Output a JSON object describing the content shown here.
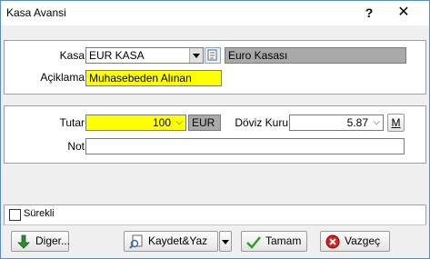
{
  "window": {
    "title": "Kasa Avansi",
    "help": "?",
    "close": "✕"
  },
  "form": {
    "kasa_label": "Kasa",
    "kasa_value": "EUR KASA",
    "kasa_name": "Euro Kasası",
    "aciklama_label": "Açiklama",
    "aciklama_value": "Muhasebeden Alınan",
    "tutar_label": "Tutar",
    "tutar_value": "100",
    "currency": "EUR",
    "doviz_label": "Döviz Kuru",
    "doviz_value": "5.87",
    "m_button": "M",
    "not_label": "Not",
    "not_value": ""
  },
  "options": {
    "surekli_label": "Sürekli",
    "surekli_checked": false
  },
  "buttons": {
    "diger": "Diger...",
    "kaydet": "Kaydet&Yaz",
    "tamam": "Tamam",
    "vazgec": "Vazgeç"
  },
  "colors": {
    "highlight": "#ffff00",
    "readonly": "#a9a9a9",
    "border": "#5a8bc4"
  }
}
